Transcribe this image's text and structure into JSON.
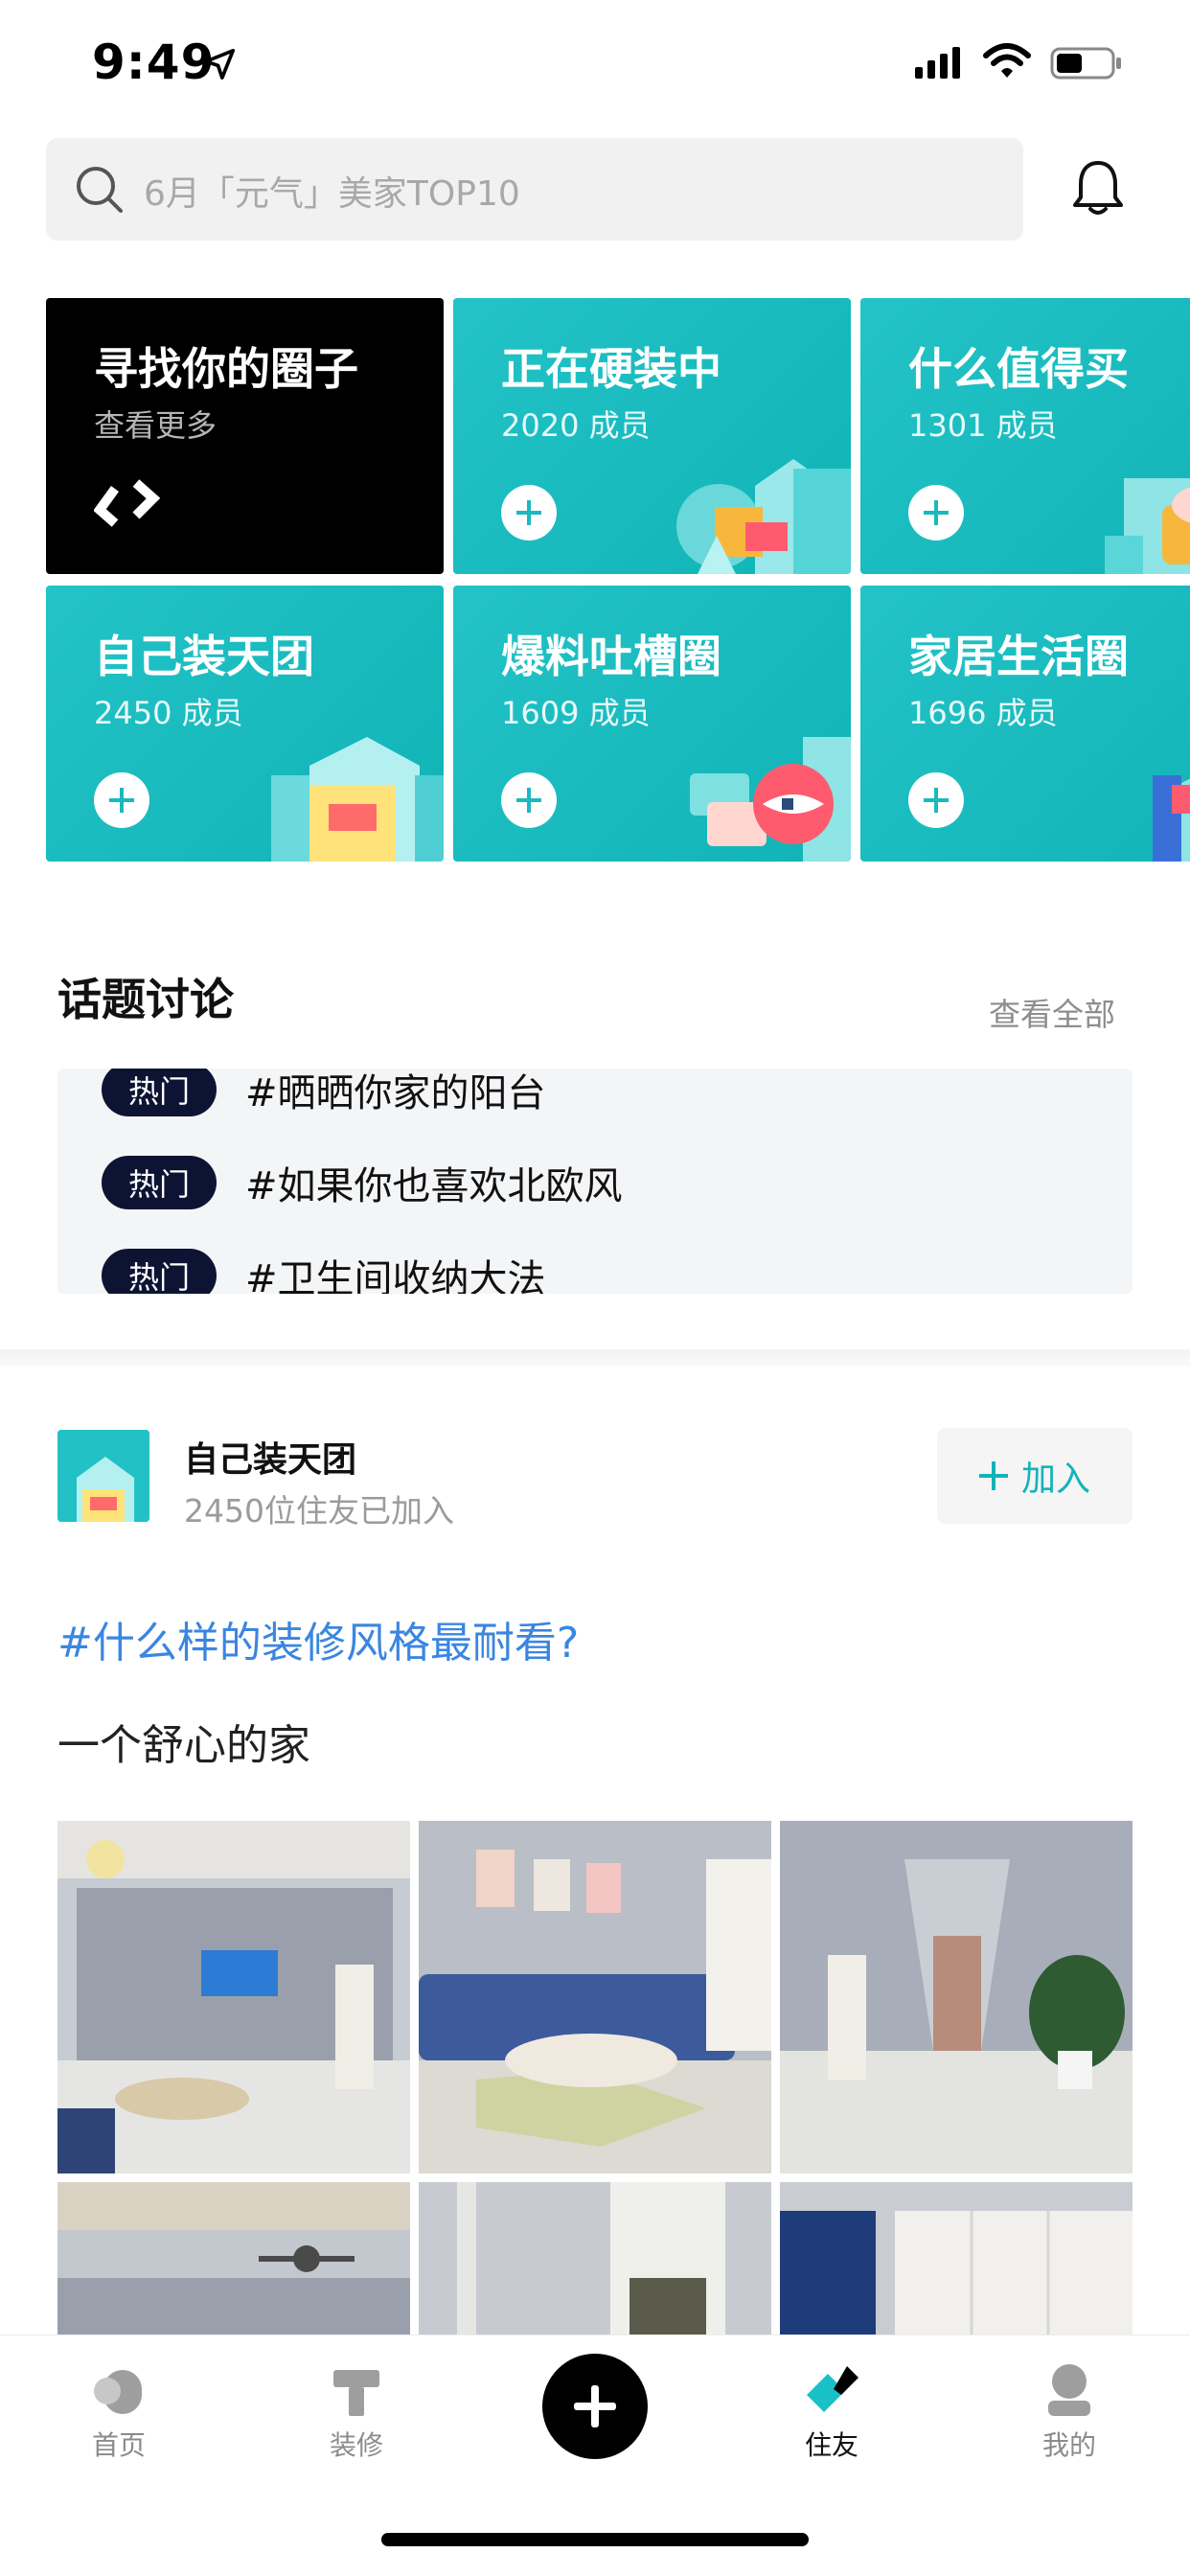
{
  "status_bar": {
    "time": "9:49"
  },
  "search": {
    "placeholder_text": "6月「元气」美家TOP10"
  },
  "circles": [
    {
      "title": "寻找你的圈子",
      "subtitle": "查看更多"
    },
    {
      "title": "正在硬装中",
      "subtitle": "2020 成员"
    },
    {
      "title": "什么值得买",
      "subtitle": "1301 成员"
    },
    {
      "title": "自己装天团",
      "subtitle": "2450 成员"
    },
    {
      "title": "爆料吐槽圈",
      "subtitle": "1609 成员"
    },
    {
      "title": "家居生活圈",
      "subtitle": "1696 成员"
    }
  ],
  "topics": {
    "title": "话题讨论",
    "view_all": "查看全部",
    "items": [
      {
        "badge": "热门",
        "text": "#晒晒你家的阳台"
      },
      {
        "badge": "热门",
        "text": "#如果你也喜欢北欧风"
      },
      {
        "badge": "热门",
        "text": "#卫生间收纳大法"
      }
    ]
  },
  "post": {
    "group_name": "自己装天团",
    "group_meta": "2450位住友已加入",
    "join_label": "加入",
    "topic": "#什么样的装修风格最耐看?",
    "title": "一个舒心的家"
  },
  "tab_bar": {
    "items": [
      {
        "label": "首页",
        "icon": "home-icon"
      },
      {
        "label": "装修",
        "icon": "renovation-icon"
      },
      {
        "label": "",
        "icon": "plus-icon"
      },
      {
        "label": "住友",
        "icon": "community-icon"
      },
      {
        "label": "我的",
        "icon": "profile-icon"
      }
    ],
    "active": "住友"
  },
  "colors": {
    "accent": "#15b3b8",
    "card_teal": "#1bbcc0",
    "link_blue": "#3a86e0",
    "badge_dark": "#0d1433"
  }
}
